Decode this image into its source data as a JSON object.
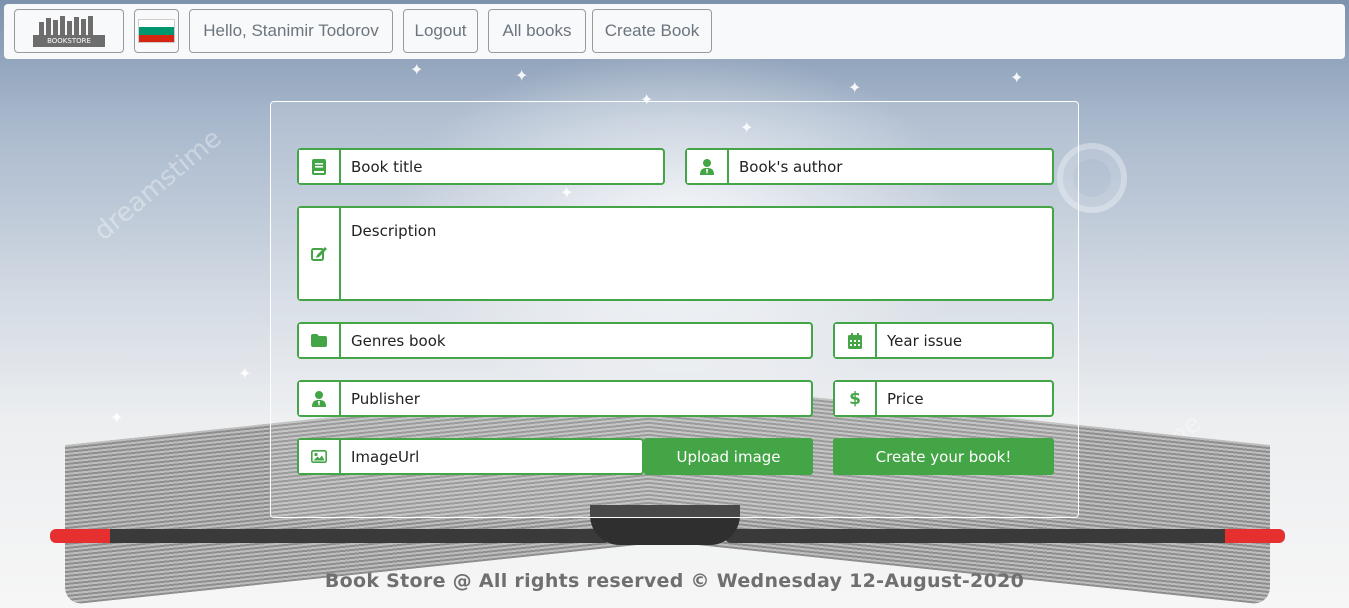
{
  "navbar": {
    "logo_text": "BOOKSTORE",
    "language_flag": "bulgaria-flag-icon",
    "greeting": "Hello, Stanimir Todorov",
    "logout": "Logout",
    "all_books": "All books",
    "create_book": "Create Book"
  },
  "form": {
    "title_placeholder": "Book title",
    "author_placeholder": "Book's author",
    "description_placeholder": "Description",
    "genres_placeholder": "Genres book",
    "year_placeholder": "Year issue",
    "publisher_placeholder": "Publisher",
    "price_placeholder": "Price",
    "image_placeholder": "ImageUrl",
    "upload_label": "Upload image",
    "submit_label": "Create your book!"
  },
  "background": {
    "watermark": "dreamstime"
  },
  "footer": {
    "text": "Book Store @ All rights reserved © Wednesday 12-August-2020"
  },
  "colors": {
    "accent": "#44a546",
    "navbar_bg": "#f8f9fa",
    "footer_text": "#6f6f6f",
    "flag_white": "#ffffff",
    "flag_green": "#00966e",
    "flag_red": "#d62612"
  }
}
